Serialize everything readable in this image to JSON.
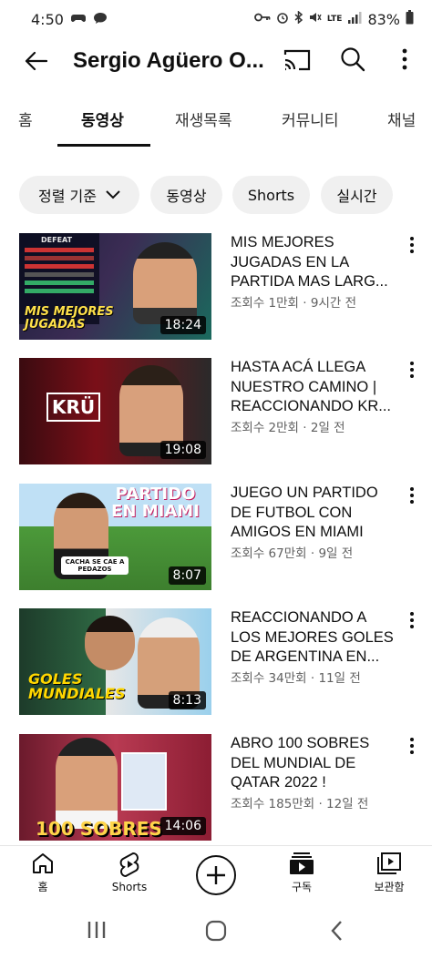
{
  "status_bar": {
    "time": "4:50",
    "lte": "LTE",
    "battery": "83%"
  },
  "header": {
    "channel_title": "Sergio Agüero O..."
  },
  "tabs": [
    {
      "label": "홈"
    },
    {
      "label": "동영상",
      "active": true
    },
    {
      "label": "재생목록"
    },
    {
      "label": "커뮤니티"
    },
    {
      "label": "채널"
    }
  ],
  "chips": {
    "sort_label": "정렬 기준",
    "videos_label": "동영상",
    "shorts_label": "Shorts",
    "live_label": "실시간"
  },
  "videos": [
    {
      "title": "MIS MEJORES JUGADAS EN LA PARTIDA MAS LARG...",
      "meta": "조회수 1만회 · 9시간 전",
      "duration": "18:24",
      "thumb_text": "MIS MEJORES JUGADAS",
      "thumb_badge": "DEFEAT"
    },
    {
      "title": "HASTA ACÁ LLEGA NUESTRO CAMINO | REACCIONANDO KR...",
      "meta": "조회수 2만회 · 2일 전",
      "duration": "19:08",
      "thumb_text": "KRÜ"
    },
    {
      "title": "JUEGO UN PARTIDO DE FUTBOL CON AMIGOS EN MIAMI",
      "meta": "조회수 67만회 · 9일 전",
      "duration": "8:07",
      "thumb_text": "PARTIDO EN MIAMI",
      "thumb_text2": "CACHA SE CAE A PEDAZOS"
    },
    {
      "title": "REACCIONANDO A LOS MEJORES GOLES DE ARGENTINA EN...",
      "meta": "조회수 34만회 · 11일 전",
      "duration": "8:13",
      "thumb_text": "GOLES MUNDIALES"
    },
    {
      "title": "ABRO 100 SOBRES DEL MUNDIAL DE QATAR 2022 !",
      "meta": "조회수 185만회 · 12일 전",
      "duration": "14:06",
      "thumb_text": "100 SOBRES"
    }
  ],
  "bottom_nav": {
    "home": "홈",
    "shorts": "Shorts",
    "subscriptions": "구독",
    "library": "보관함"
  },
  "colors": {
    "text": "#0f0f0f",
    "secondary": "#606060",
    "chip_bg": "#f0f0f0"
  }
}
